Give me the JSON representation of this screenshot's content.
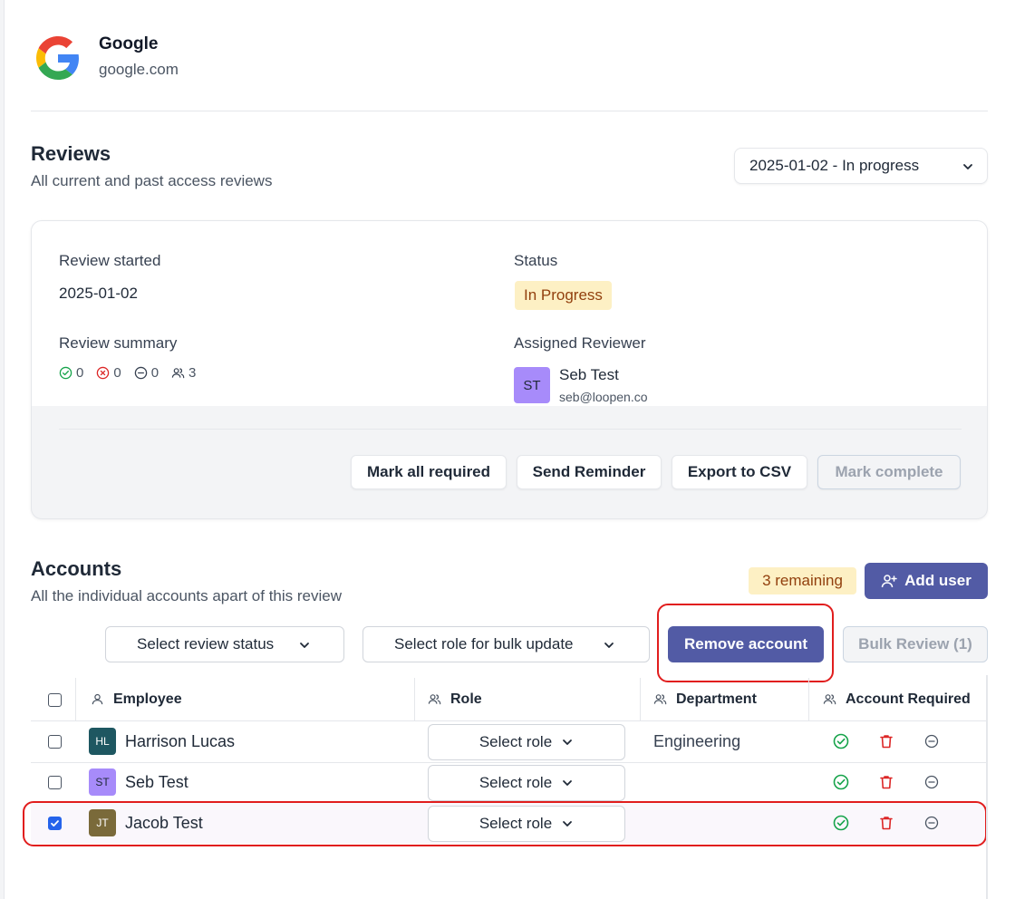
{
  "app": {
    "name": "Google",
    "domain": "google.com",
    "logo_icon": "google-g-logo"
  },
  "reviews": {
    "title": "Reviews",
    "subtitle": "All current and past access reviews",
    "selected_review": "2025-01-02 - In progress"
  },
  "review_card": {
    "started_label": "Review started",
    "started_value": "2025-01-02",
    "status_label": "Status",
    "status_value": "In Progress",
    "summary_label": "Review summary",
    "summary": {
      "approved": "0",
      "rejected": "0",
      "neutral": "0",
      "users": "3"
    },
    "reviewer_label": "Assigned Reviewer",
    "reviewer": {
      "initials": "ST",
      "name": "Seb Test",
      "email": "seb@loopen.co"
    },
    "buttons": {
      "mark_all_required": "Mark all required",
      "send_reminder": "Send Reminder",
      "export_csv": "Export to CSV",
      "mark_complete": "Mark complete"
    }
  },
  "accounts": {
    "title": "Accounts",
    "subtitle": "All the individual accounts apart of this review",
    "remaining": "3 remaining",
    "add_user": "Add user",
    "filter_status": "Select review status",
    "filter_role": "Select role for bulk update",
    "remove_account": "Remove account",
    "bulk_review": "Bulk Review (1)"
  },
  "table": {
    "headers": {
      "employee": "Employee",
      "role": "Role",
      "department": "Department",
      "account_required": "Account Required"
    },
    "rows": [
      {
        "initials": "HL",
        "name": "Harrison Lucas",
        "role": "Select role",
        "department": "Engineering",
        "checked": false,
        "avatar_color": "#1e5761"
      },
      {
        "initials": "ST",
        "name": "Seb Test",
        "role": "Select role",
        "department": "",
        "checked": false,
        "avatar_color": "#a78bfa"
      },
      {
        "initials": "JT",
        "name": "Jacob Test",
        "role": "Select role",
        "department": "",
        "checked": true,
        "avatar_color": "#7a6a3a"
      }
    ]
  },
  "colors": {
    "primary": "#525ba5",
    "badge_bg": "#fdf0c4",
    "badge_text": "#92400e",
    "approve": "#16a34a",
    "delete": "#dc2626",
    "annotation": "#e11d1d"
  }
}
